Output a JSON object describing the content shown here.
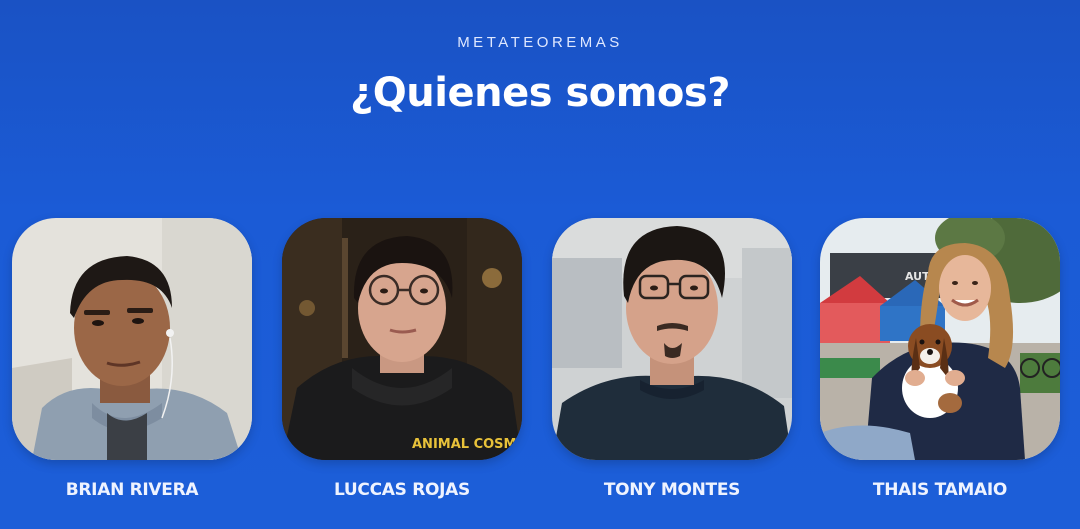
{
  "header": {
    "kicker": "METATEOREMAS",
    "title": "¿Quienes somos?"
  },
  "team": [
    {
      "name": "BRIAN RIVERA"
    },
    {
      "name": "LUCCAS ROJAS",
      "shirt_print": "ANIMAL COSMIC"
    },
    {
      "name": "TONY MONTES"
    },
    {
      "name": "THAIS TAMAIO",
      "sign_text": "AUTO"
    }
  ],
  "colors": {
    "background": "#1b5bd6",
    "text": "#ffffff"
  }
}
